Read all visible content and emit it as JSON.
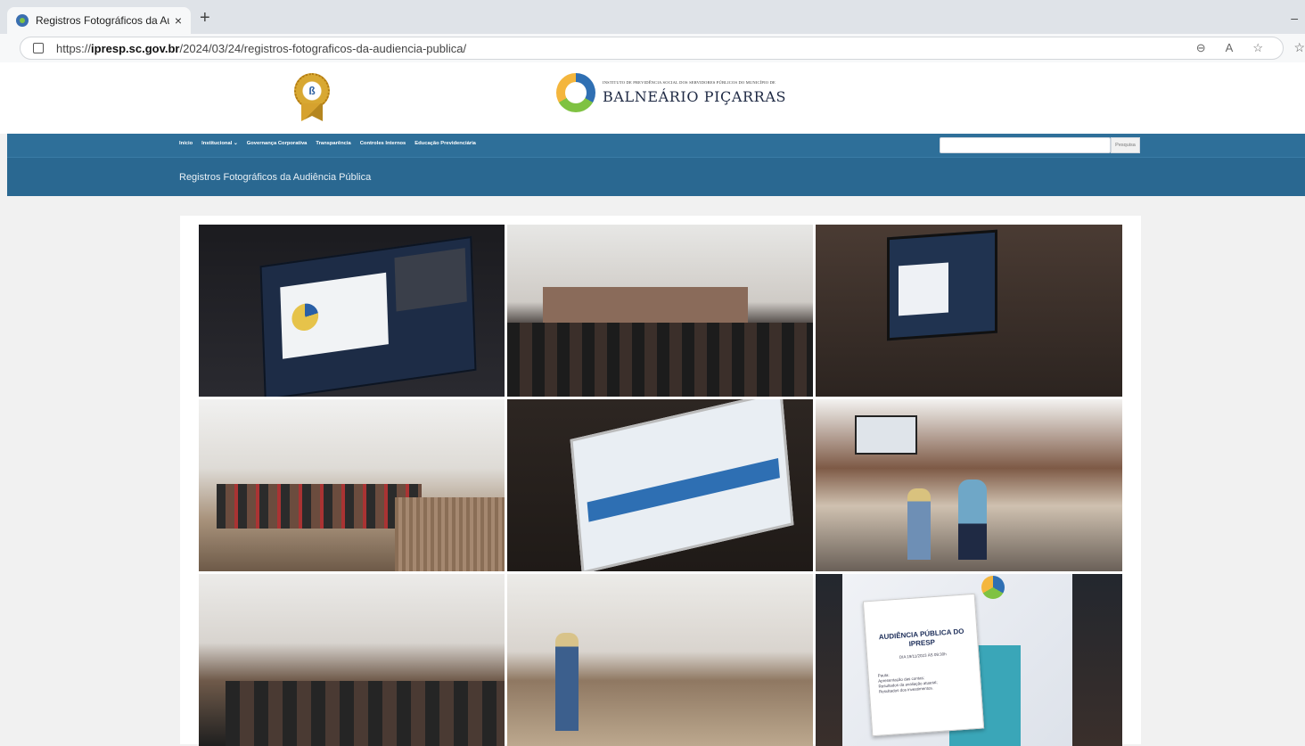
{
  "browser": {
    "tab_title": "Registros Fotográficos da Audiênc",
    "tab_close": "×",
    "new_tab": "+",
    "url_prefix": "https://",
    "url_domain": "ipresp.sc.gov.br",
    "url_path": "/2024/03/24/registros-fotograficos-da-audiencia-publica/"
  },
  "header": {
    "logo_small": "INSTITUTO DE PREVIDÊNCIA SOCIAL DOS SERVIDORES PÚBLICOS DO MUNICÍPIO DE",
    "logo_big": "BALNEÁRIO PIÇARRAS"
  },
  "nav": {
    "items": [
      "Início",
      "Institucional ⌄",
      "Governança Corporativa",
      "Transparência",
      "Controles Internos",
      "Educação Previdenciária"
    ],
    "search_button": "Pesquisa"
  },
  "page": {
    "title": "Registros Fotográficos da Audiência Pública"
  },
  "poster": {
    "heading": "AUDIÊNCIA PÚBLICA DO IPRESP",
    "date": "DIA 19/11/2023 ÀS 09:30h",
    "lines": [
      "Pauta:",
      "Apresentação das contas;",
      "Resultados da avaliação atuarial;",
      "Resultados dos investimentos."
    ]
  },
  "colors": {
    "nav": "#2e6f99",
    "title_bar": "#2a6891"
  }
}
